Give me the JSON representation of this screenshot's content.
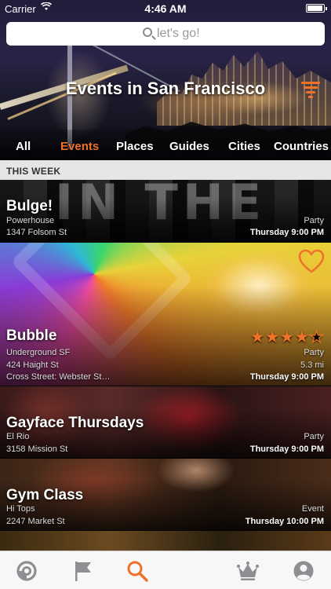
{
  "status_bar": {
    "carrier": "Carrier",
    "time": "4:46 AM"
  },
  "search": {
    "placeholder": "let's go!"
  },
  "header": {
    "title": "Events in San Francisco"
  },
  "tabs": [
    {
      "label": "All",
      "active": false
    },
    {
      "label": "Events",
      "active": true
    },
    {
      "label": "Places",
      "active": false
    },
    {
      "label": "Guides",
      "active": false
    },
    {
      "label": "Cities",
      "active": false
    },
    {
      "label": "Countries",
      "active": false
    }
  ],
  "section": {
    "title": "THIS WEEK"
  },
  "events": [
    {
      "name": "Bulge!",
      "venue": "Powerhouse",
      "address": "1347 Folsom St",
      "category": "Party",
      "when": "Thursday 9:00 PM"
    },
    {
      "name": "Bubble",
      "venue": "Underground SF",
      "address": "424 Haight St",
      "cross_street": "Cross Street: Webster St…",
      "category": "Party",
      "distance": "5.3 mi",
      "when": "Thursday 9:00 PM",
      "rating": 4,
      "rating_max": 5,
      "favorited": false
    },
    {
      "name": "Gayface Thursdays",
      "venue": "El Rio",
      "address": "3158 Mission St",
      "category": "Party",
      "when": "Thursday 9:00 PM"
    },
    {
      "name": "Gym Class",
      "venue": "Hi Tops",
      "address": "2247 Market St",
      "category": "Event",
      "when": "Thursday 10:00 PM"
    }
  ],
  "tab_bar": {
    "items": [
      {
        "icon": "compass-icon",
        "active": false
      },
      {
        "icon": "flag-icon",
        "active": false
      },
      {
        "icon": "search-icon",
        "active": true
      },
      {
        "icon": "crown-icon",
        "active": false
      },
      {
        "icon": "profile-icon",
        "active": false
      }
    ]
  },
  "colors": {
    "accent": "#f0722a",
    "section_bg": "#e6e6e6",
    "tabbar_bg": "#f7f7f7",
    "inactive_icon": "#8e8e93"
  }
}
